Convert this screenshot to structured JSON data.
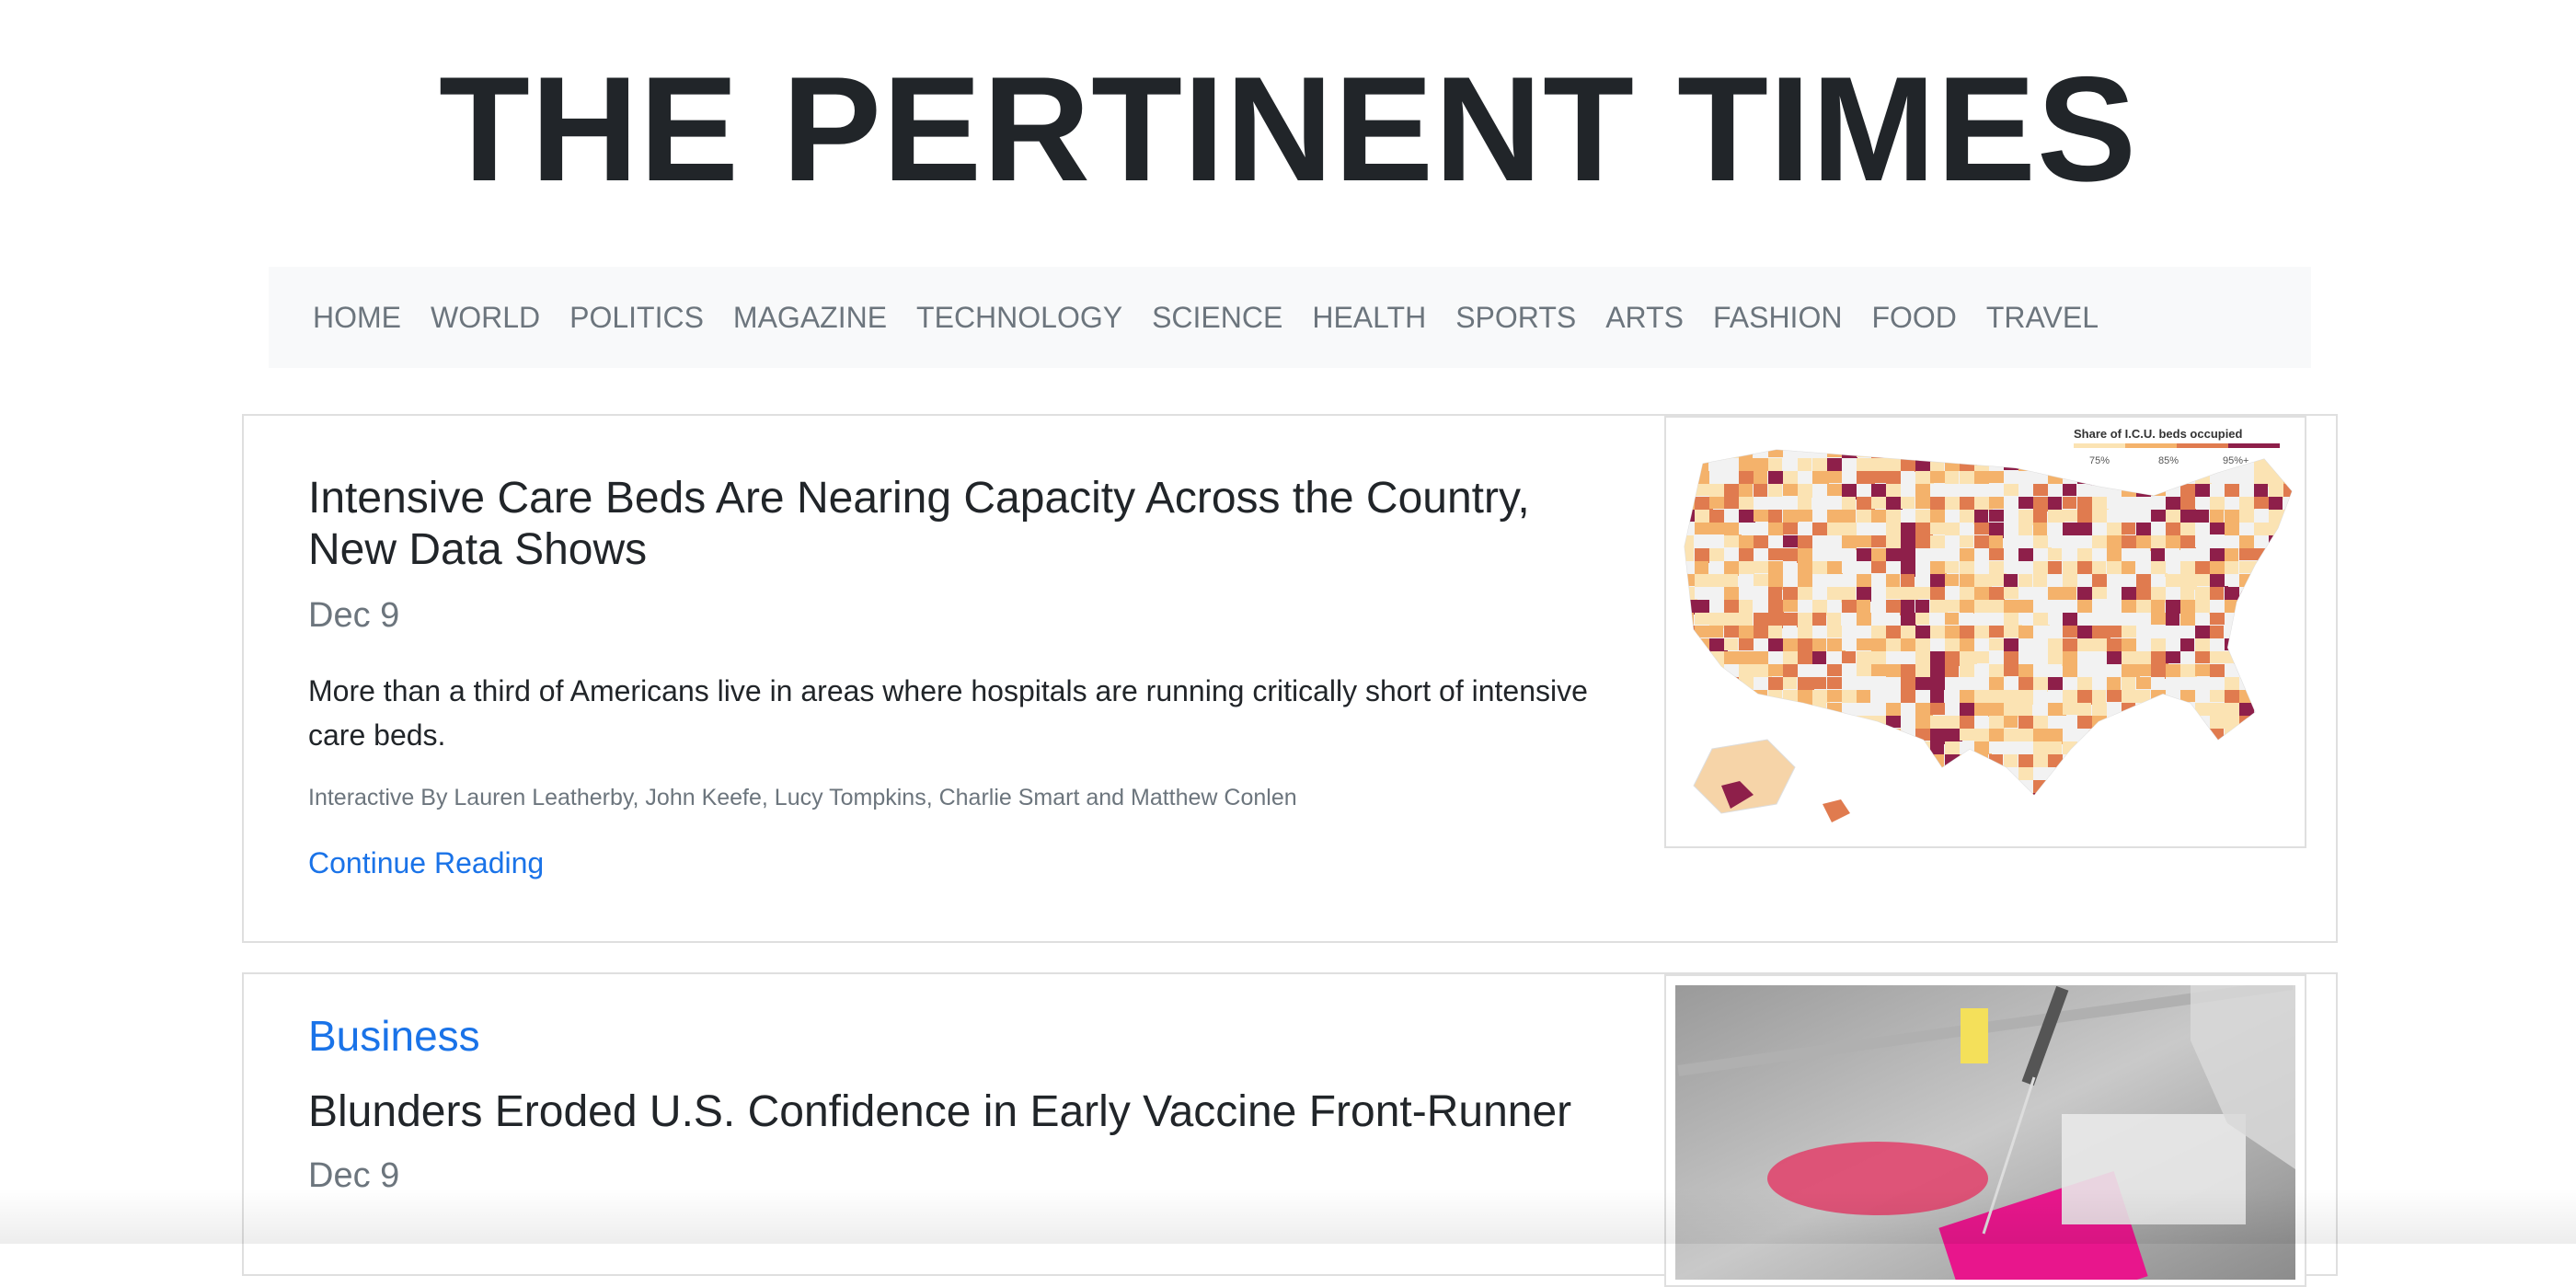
{
  "site": {
    "title": "THE PERTINENT TIMES"
  },
  "nav": {
    "items": [
      "HOME",
      "WORLD",
      "POLITICS",
      "MAGAZINE",
      "TECHNOLOGY",
      "SCIENCE",
      "HEALTH",
      "SPORTS",
      "ARTS",
      "FASHION",
      "FOOD",
      "TRAVEL"
    ]
  },
  "articles": [
    {
      "headline": "Intensive Care Beds Are Nearing Capacity Across the Country, New Data Shows",
      "date": "Dec 9",
      "summary": "More than a third of Americans live in areas where hospitals are running critically short of intensive care beds.",
      "byline": "Interactive By Lauren Leatherby, John Keefe, Lucy Tompkins, Charlie Smart and Matthew Conlen",
      "link": "Continue Reading",
      "image": {
        "legend_title": "Share of I.C.U. beds occupied",
        "legend_ticks": [
          "75%",
          "85%",
          "95%+"
        ]
      }
    },
    {
      "category": "Business",
      "headline": "Blunders Eroded U.S. Confidence in Early Vaccine Front-Runner",
      "date": "Dec 9"
    }
  ],
  "colors": {
    "link": "#1a73e8",
    "text": "#212529",
    "muted": "#6c757d",
    "nav_bg": "#f8f9fa",
    "map_scale": [
      "#fbe3b3",
      "#f4b26b",
      "#e07b4f",
      "#8e1f4a"
    ]
  }
}
